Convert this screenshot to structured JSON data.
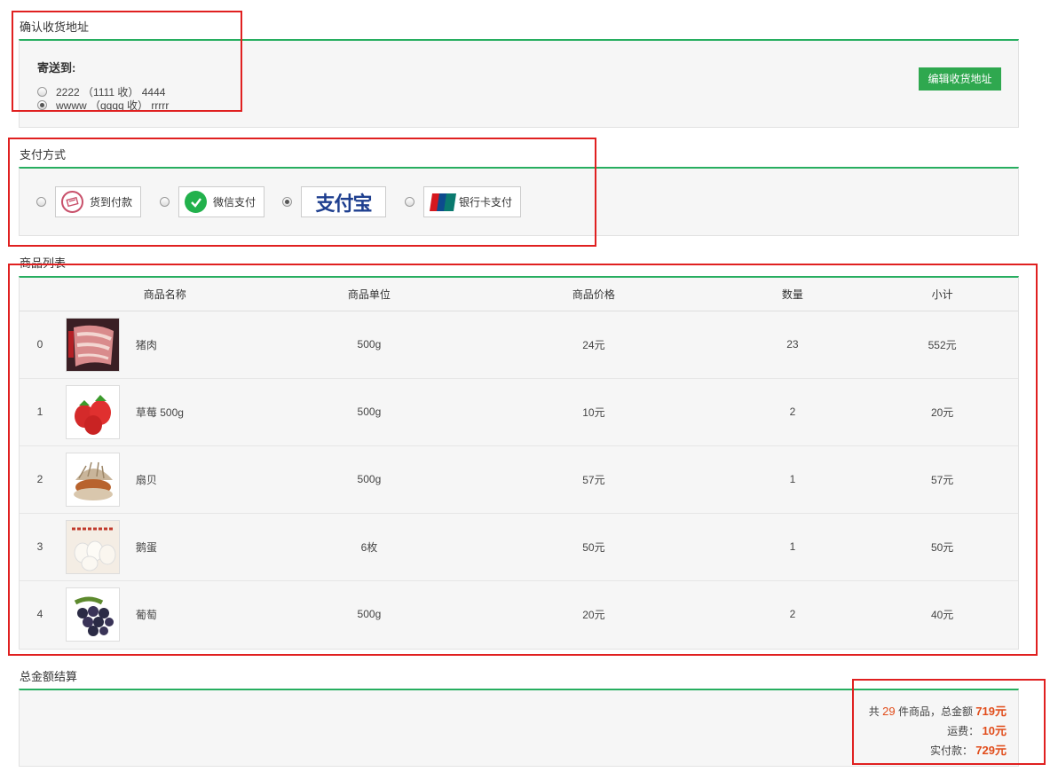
{
  "address": {
    "section_title": "确认收货地址",
    "send_to_label": "寄送到:",
    "options": [
      {
        "text": "2222 （1111 收） 4444",
        "checked": false
      },
      {
        "text": "wwww （qqqq 收） rrrrr",
        "checked": true
      }
    ],
    "edit_button": "编辑收货地址"
  },
  "payment": {
    "section_title": "支付方式",
    "options": [
      {
        "label": "货到付款",
        "icon": "cash-on-delivery-icon",
        "checked": false
      },
      {
        "label": "微信支付",
        "icon": "wechat-pay-icon",
        "checked": false
      },
      {
        "label": "支付宝",
        "icon": "alipay-logo",
        "checked": true
      },
      {
        "label": "银行卡支付",
        "icon": "unionpay-icon",
        "checked": false
      }
    ]
  },
  "products": {
    "section_title": "商品列表",
    "headers": [
      "商品名称",
      "商品单位",
      "商品价格",
      "数量",
      "小计"
    ],
    "rows": [
      {
        "index": "0",
        "name": "猪肉",
        "unit": "500g",
        "price": "24元",
        "qty": "23",
        "subtotal": "552元",
        "thumb": "pork-image"
      },
      {
        "index": "1",
        "name": "草莓 500g",
        "unit": "500g",
        "price": "10元",
        "qty": "2",
        "subtotal": "20元",
        "thumb": "strawberry-image"
      },
      {
        "index": "2",
        "name": "扇贝",
        "unit": "500g",
        "price": "57元",
        "qty": "1",
        "subtotal": "57元",
        "thumb": "scallop-image"
      },
      {
        "index": "3",
        "name": "鹅蛋",
        "unit": "6枚",
        "price": "50元",
        "qty": "1",
        "subtotal": "50元",
        "thumb": "goose-egg-image"
      },
      {
        "index": "4",
        "name": "葡萄",
        "unit": "500g",
        "price": "20元",
        "qty": "2",
        "subtotal": "40元",
        "thumb": "grape-image"
      }
    ]
  },
  "totals": {
    "section_title": "总金额结算",
    "count_prefix": "共",
    "count": "29",
    "count_suffix": "件商品，总金额",
    "total_amount": "719元",
    "shipping_label": "运费：",
    "shipping": "10元",
    "paid_label": "实付款：",
    "paid": "729元"
  },
  "colors": {
    "accent": "#27ae60",
    "button": "#2fa84f",
    "highlight": "#e14c1a",
    "annotation": "#e02020"
  }
}
